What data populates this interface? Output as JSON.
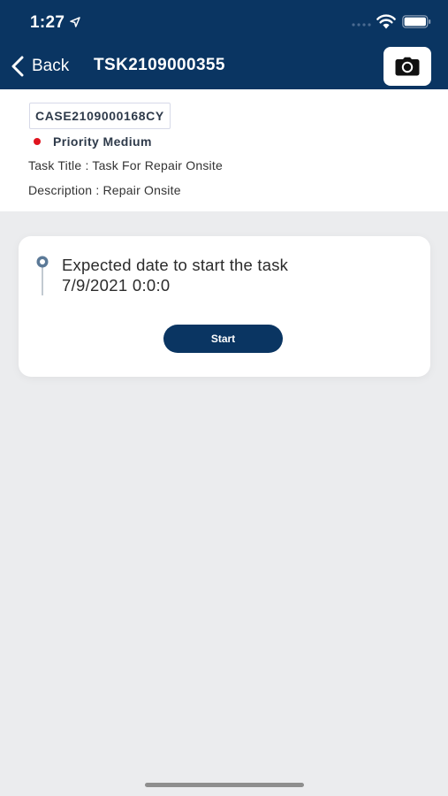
{
  "status_bar": {
    "time": "1:27",
    "icons": [
      "location-arrow-icon",
      "signal-dots-icon",
      "wifi-icon",
      "battery-icon"
    ]
  },
  "nav": {
    "back_label": "Back",
    "title": "TSK2109000355",
    "camera_icon": "camera-icon"
  },
  "case": {
    "id": "CASE2109000168CY",
    "priority": "Priority Medium",
    "priority_color": "#e0141e",
    "task_title": "Task Title : Task For Repair Onsite",
    "description": "Description : Repair Onsite"
  },
  "task_card": {
    "label": "Expected date to start the task",
    "date": "7/9/2021 0:0:0",
    "start_button": "Start",
    "pin_icon": "map-pin-icon"
  },
  "colors": {
    "primary": "#0a3562",
    "background": "#ebecee",
    "card": "#ffffff"
  }
}
